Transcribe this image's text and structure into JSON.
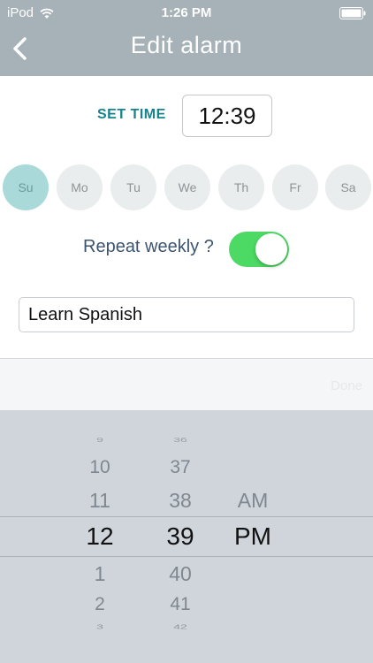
{
  "status_bar": {
    "carrier": "iPod",
    "time": "1:26 PM",
    "wifi_icon": "wifi-icon",
    "battery_icon": "battery-icon"
  },
  "header": {
    "title": "Edit alarm",
    "back_icon": "chevron-left-icon"
  },
  "set_time": {
    "label": "SET TIME",
    "value": "12:39"
  },
  "days": [
    {
      "label": "Su",
      "selected": true
    },
    {
      "label": "Mo",
      "selected": false
    },
    {
      "label": "Tu",
      "selected": false
    },
    {
      "label": "We",
      "selected": false
    },
    {
      "label": "Th",
      "selected": false
    },
    {
      "label": "Fr",
      "selected": false
    },
    {
      "label": "Sa",
      "selected": false
    }
  ],
  "repeat": {
    "label": "Repeat weekly ?",
    "enabled": true
  },
  "alarm_name": {
    "value": "Learn Spanish",
    "placeholder": ""
  },
  "picker": {
    "done_label": "Done",
    "hours": {
      "above": [
        "9",
        "10",
        "11"
      ],
      "selected": "12",
      "below": [
        "1",
        "2",
        "3"
      ]
    },
    "minutes": {
      "above": [
        "36",
        "37",
        "38"
      ],
      "selected": "39",
      "below": [
        "40",
        "41",
        "42"
      ]
    },
    "period": {
      "above": [
        "AM"
      ],
      "selected": "PM",
      "below": []
    }
  },
  "colors": {
    "header_bg": "#a6b2b8",
    "accent_teal": "#16838f",
    "toggle_on": "#4cd964",
    "day_selected_bg": "#a9d9d9",
    "day_bg": "#e9edee",
    "picker_bg": "#d0d5dc"
  }
}
